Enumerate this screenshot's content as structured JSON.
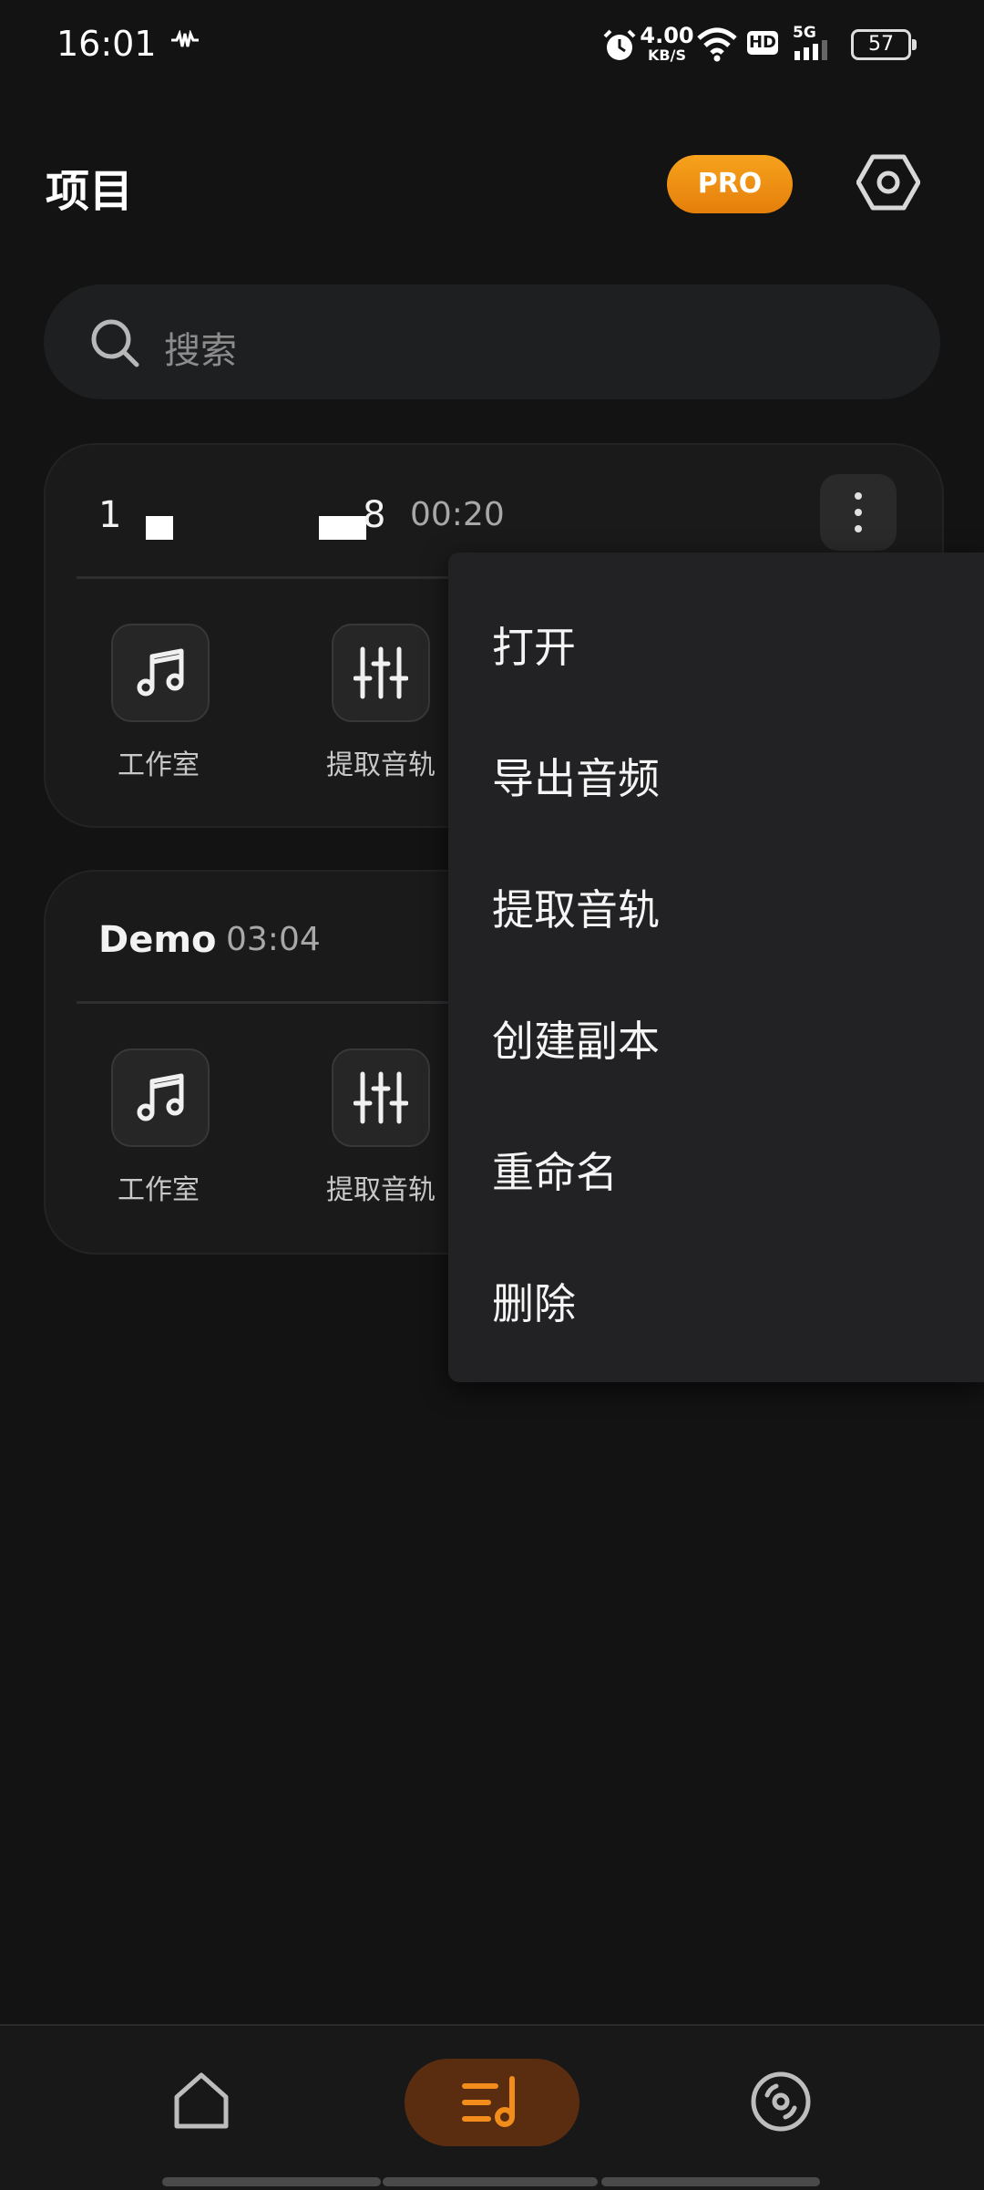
{
  "status_bar": {
    "time": "16:01",
    "net_speed_value": "4.00",
    "net_speed_unit": "KB/S",
    "hd_label": "HD",
    "network_label": "5G",
    "battery": "57"
  },
  "header": {
    "title": "项目",
    "pro_label": "PRO"
  },
  "search": {
    "placeholder": "搜索"
  },
  "projects": [
    {
      "name_left": "1",
      "name_right": "8",
      "duration": "00:20",
      "actions": [
        "工作室",
        "提取音轨"
      ]
    },
    {
      "name": "Demo",
      "duration": "03:04",
      "actions": [
        "工作室",
        "提取音轨"
      ]
    }
  ],
  "context_menu": {
    "items": [
      "打开",
      "导出音频",
      "提取音轨",
      "创建副本",
      "重命名",
      "删除"
    ]
  },
  "colors": {
    "accent": "#f28c1a",
    "background": "#131313",
    "card": "#1a1a1b",
    "menu": "#222224"
  },
  "nav": {
    "items": [
      "home-icon",
      "projects-icon",
      "disc-icon"
    ],
    "active_index": 1
  }
}
